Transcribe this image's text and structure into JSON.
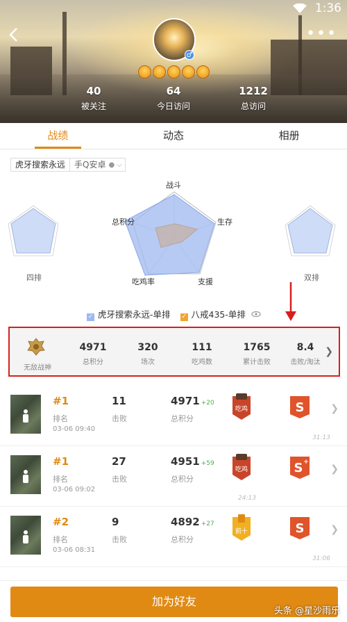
{
  "status": {
    "time": "1:36"
  },
  "profile": {
    "stats": [
      {
        "value": "40",
        "label": "被关注"
      },
      {
        "value": "64",
        "label": "今日访问"
      },
      {
        "value": "1212",
        "label": "总访问"
      }
    ],
    "gender": "♂"
  },
  "tabs": [
    "战绩",
    "动态",
    "相册"
  ],
  "selector": {
    "player": "虎牙搜索永远",
    "platform": "手Q安卓"
  },
  "radar": {
    "labels": {
      "top": "战斗",
      "right": "生存",
      "bottom_right": "支援",
      "bottom_left": "吃鸡率",
      "left": "总积分"
    },
    "side_left": "四排",
    "side_right": "双排"
  },
  "legend": [
    {
      "label": "虎牙搜索永远-单排",
      "color": "#9db8f0"
    },
    {
      "label": "八戒435-单排",
      "color": "#f0a531"
    }
  ],
  "summary": {
    "rank_name": "无敌战神",
    "items": [
      {
        "value": "4971",
        "label": "总积分"
      },
      {
        "value": "320",
        "label": "场次"
      },
      {
        "value": "111",
        "label": "吃鸡数"
      },
      {
        "value": "1765",
        "label": "累计击败"
      },
      {
        "value": "8.4",
        "label": "击败/淘汰"
      }
    ]
  },
  "matches": [
    {
      "rank": "#1",
      "rank_label": "排名",
      "datetime": "03-06 09:40",
      "kills": "11",
      "kills_label": "击败",
      "points": "4971",
      "delta": "+20",
      "points_label": "总积分",
      "medal": "吃鸡",
      "duration": "31:13"
    },
    {
      "rank": "#1",
      "rank_label": "排名",
      "datetime": "03-06 09:02",
      "kills": "27",
      "kills_label": "击败",
      "points": "4951",
      "delta": "+59",
      "points_label": "总积分",
      "medal": "吃鸡",
      "duration": "24:13"
    },
    {
      "rank": "#2",
      "rank_label": "排名",
      "datetime": "03-06 08:31",
      "kills": "9",
      "kills_label": "击败",
      "points": "4892",
      "delta": "+27",
      "points_label": "总积分",
      "medal": "前十",
      "duration": "31:06"
    }
  ],
  "add_friend": "加为好友",
  "watermark": "头条 @星沙雨乐"
}
